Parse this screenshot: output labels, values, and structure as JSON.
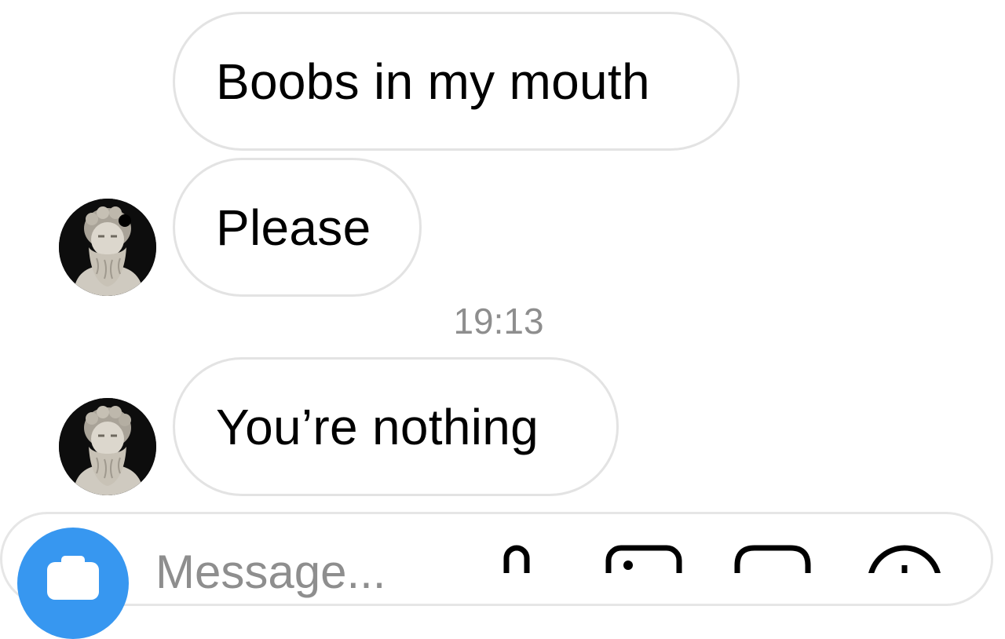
{
  "thread": {
    "messages": [
      {
        "text": "Boobs in my mouth"
      },
      {
        "text": "Please"
      },
      {
        "text": "You’re nothing"
      }
    ],
    "timestamp": "19:13"
  },
  "composer": {
    "placeholder": "Message..."
  },
  "icons": {
    "avatar": "statue-avatar",
    "camera": "camera-icon",
    "mic": "microphone-icon",
    "gallery": "gallery-icon",
    "sticker": "sticker-icon",
    "add": "add-icon"
  },
  "colors": {
    "accent": "#3797f0",
    "bubble_border": "#e3e3e3",
    "timestamp": "#8e8e8e"
  }
}
